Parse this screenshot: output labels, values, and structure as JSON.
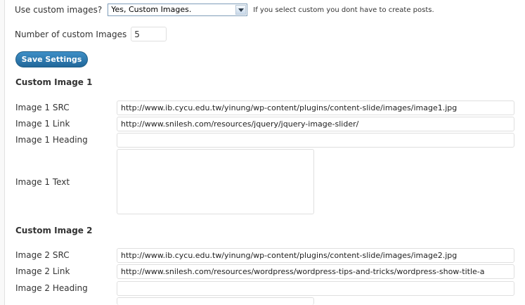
{
  "settings": {
    "use_custom_label": "Use custom images?",
    "use_custom_value": "Yes, Custom Images.",
    "use_custom_hint": "If you select custom you dont have to create posts.",
    "count_label": "Number of custom Images",
    "count_value": "5",
    "save_label": "Save Settings"
  },
  "images": [
    {
      "title": "Custom Image 1",
      "src_label": "Image 1 SRC",
      "src_value": "http://www.ib.cycu.edu.tw/yinung/wp-content/plugins/content-slide/images/image1.jpg",
      "link_label": "Image 1 Link",
      "link_value": "http://www.snilesh.com/resources/jquery/jquery-image-slider/",
      "heading_label": "Image 1 Heading",
      "heading_value": "",
      "text_label": "Image 1 Text"
    },
    {
      "title": "Custom Image 2",
      "src_label": "Image 2 SRC",
      "src_value": "http://www.ib.cycu.edu.tw/yinung/wp-content/plugins/content-slide/images/image2.jpg",
      "link_label": "Image 2 Link",
      "link_value": "http://www.snilesh.com/resources/wordpress/wordpress-tips-and-tricks/wordpress-show-title-a",
      "heading_label": "Image 2 Heading",
      "heading_value": ""
    }
  ],
  "icons": {
    "select_arrow": "chevron-down-icon"
  },
  "colors": {
    "button_top": "#3e8fc6",
    "button_bottom": "#21679a",
    "field_border": "#dfdfdf"
  }
}
